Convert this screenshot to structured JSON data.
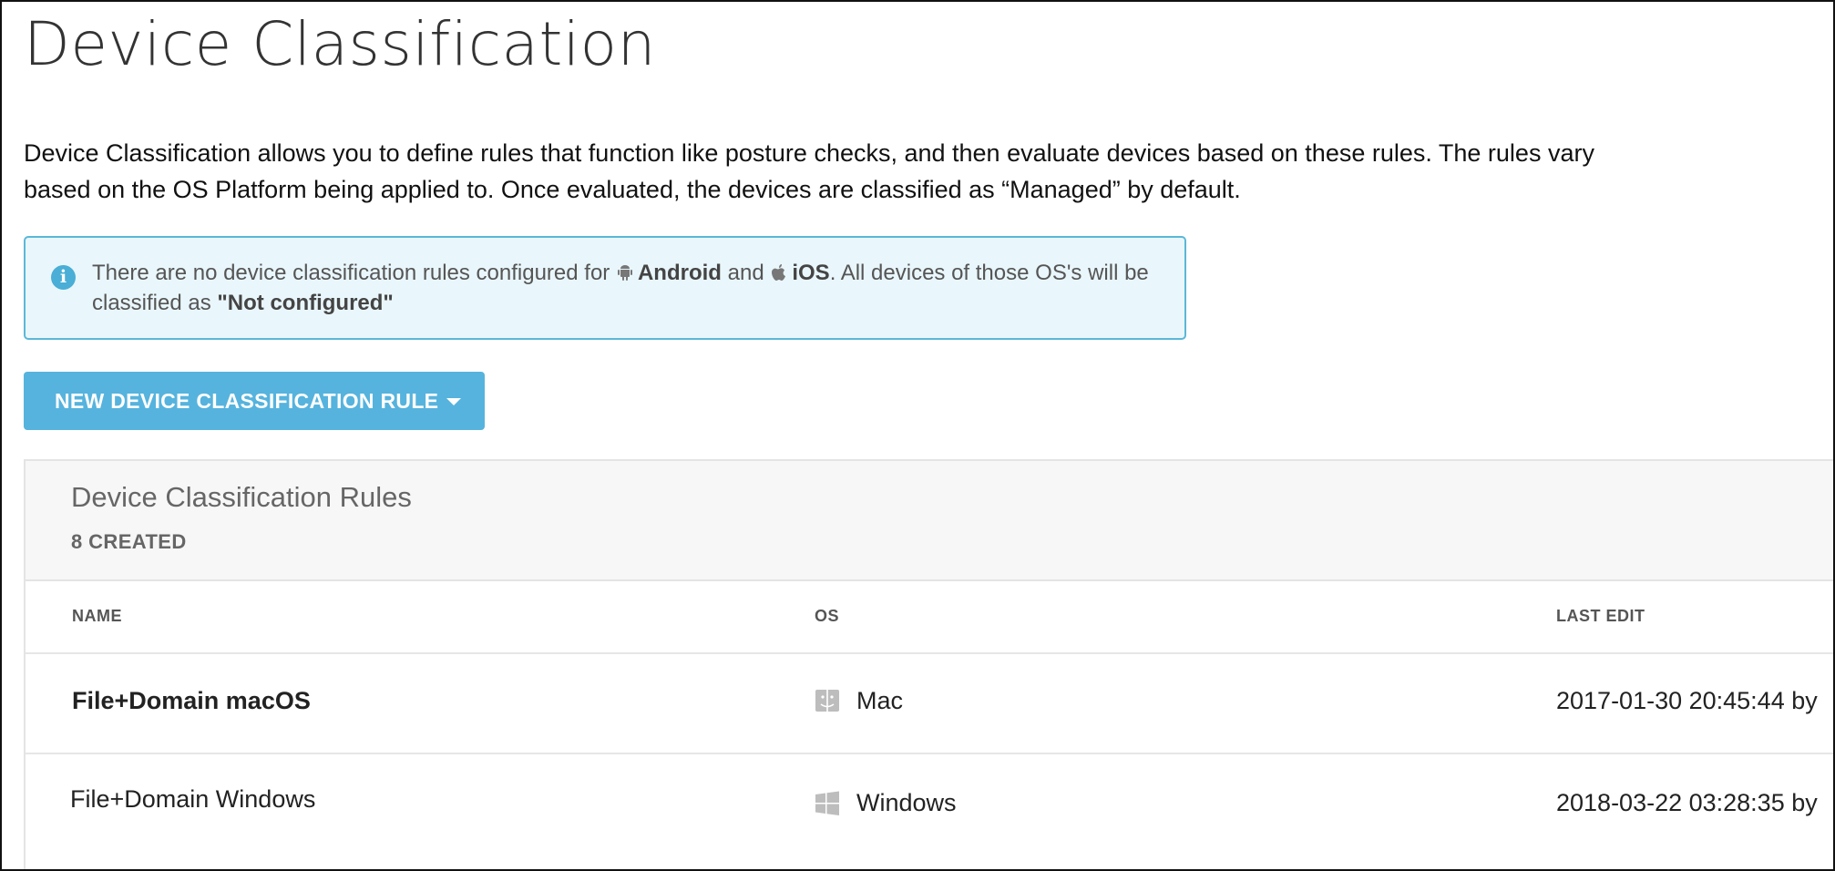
{
  "page": {
    "title": "Device Classification",
    "intro": "Device Classification allows you to define rules that function like posture checks, and then evaluate devices based on these rules. The rules vary based on the OS Platform being applied to. Once evaluated, the devices are classified as “Managed” by default."
  },
  "notice": {
    "icon": "info-icon",
    "prefix": "There are no device classification rules configured for",
    "os1": "Android",
    "os1_icon": "android-icon",
    "and": "and",
    "os2": "iOS",
    "os2_icon": "apple-icon",
    "suffix": ". All devices of those OS's will be classified as",
    "status": "\"Not configured\""
  },
  "actions": {
    "new_rule_label": "NEW DEVICE CLASSIFICATION RULE",
    "new_rule_icon": "caret-down-icon"
  },
  "rules_panel": {
    "title": "Device Classification Rules",
    "count": "8 CREATED",
    "columns": {
      "name": "NAME",
      "os": "OS",
      "last_edit": "LAST EDIT"
    },
    "rows": [
      {
        "name": "File+Domain macOS",
        "os": "Mac",
        "os_icon": "mac-finder-icon",
        "last_edit": "2017-01-30 20:45:44 by"
      },
      {
        "name": "File+Domain Windows",
        "os": "Windows",
        "os_icon": "windows-icon",
        "last_edit": "2018-03-22 03:28:35 by"
      }
    ]
  },
  "colors": {
    "accent": "#56b3dd",
    "notice_bg": "#e9f6fb",
    "notice_border": "#5bb8d8"
  }
}
